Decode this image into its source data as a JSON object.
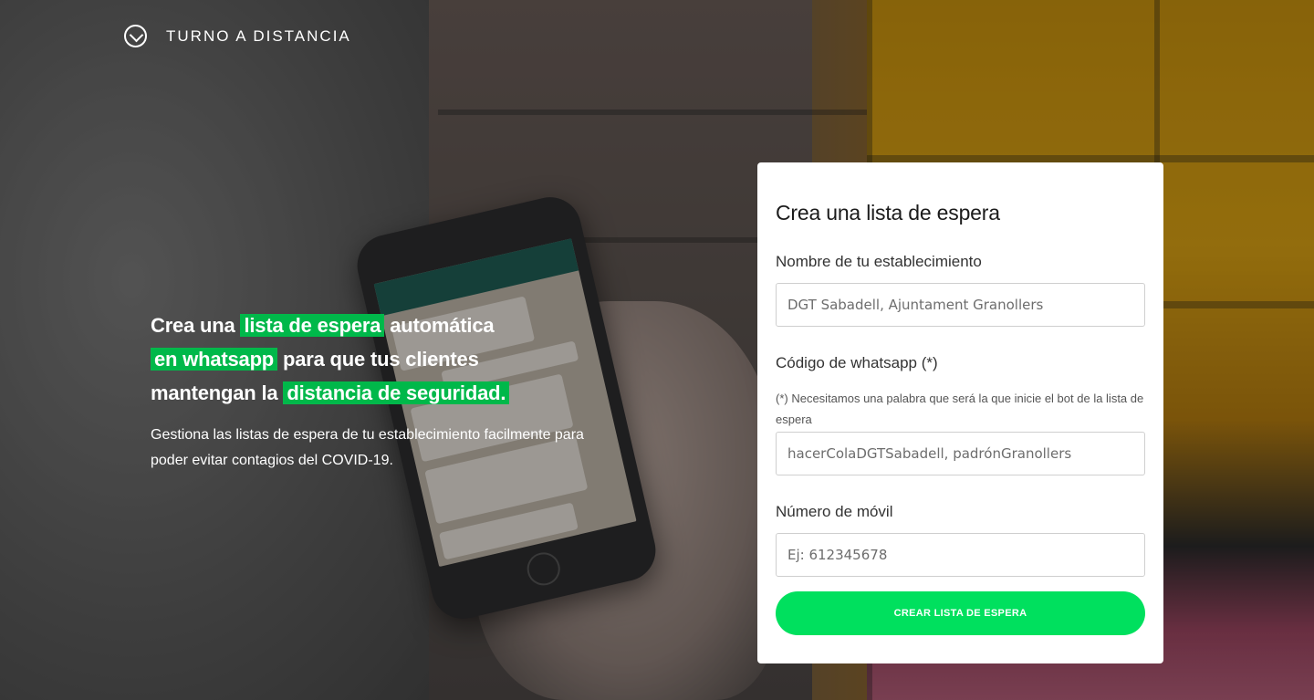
{
  "header": {
    "brand": "TURNO A DISTANCIA",
    "logo_icon": "chevron-circle-icon"
  },
  "hero": {
    "line1_pre": "Crea una",
    "line1_highlight": "lista de espera",
    "line1_post": "automática",
    "line2_highlight": "en whatsapp",
    "line2_post": "para que tus clientes",
    "line3_pre": "mantengan la",
    "line3_highlight": "distancia de seguridad.",
    "description": "Gestiona las listas de espera de tu establecimiento facilmente para poder evitar contagios del COVID-19."
  },
  "form": {
    "title": "Crea una lista de espera",
    "name_label": "Nombre de tu establecimiento",
    "name_placeholder": "DGT Sabadell, Ajuntament Granollers",
    "code_label": "Código de whatsapp (*)",
    "code_hint": "(*) Necesitamos una palabra que será la que inicie el bot de la lista de espera",
    "code_placeholder": "hacerColaDGTSabadell, padrónGranollers",
    "phone_label": "Número de móvil",
    "phone_placeholder": "Ej: 612345678",
    "submit_label": "CREAR LISTA DE ESPERA"
  },
  "colors": {
    "highlight": "#00b84a",
    "button": "#00e05e"
  }
}
